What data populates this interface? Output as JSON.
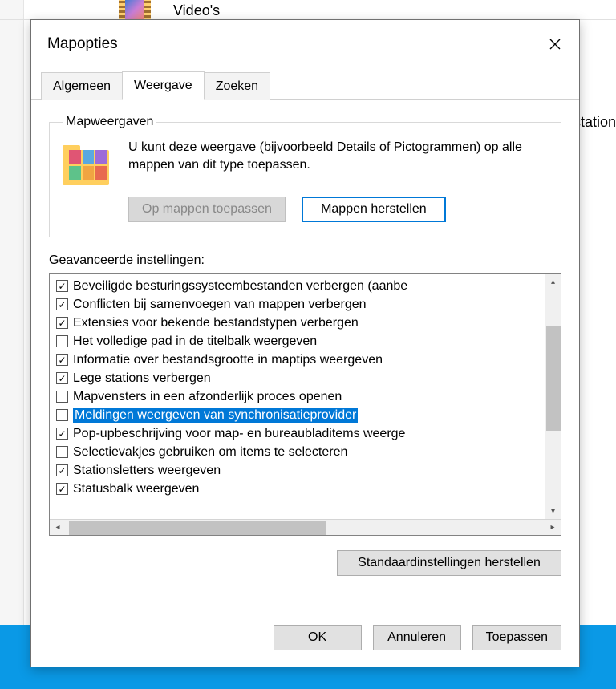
{
  "background": {
    "videos_label": "Video's",
    "station_fragment": "d-station"
  },
  "dialog": {
    "title": "Mapopties",
    "tabs": [
      "Algemeen",
      "Weergave",
      "Zoeken"
    ],
    "active_tab_index": 1,
    "mapweergaven": {
      "legend": "Mapweergaven",
      "description": "U kunt deze weergave (bijvoorbeeld Details of Pictogrammen) op alle mappen van dit type toepassen.",
      "apply_button": "Op mappen toepassen",
      "reset_button": "Mappen herstellen"
    },
    "advanced_label": "Geavanceerde instellingen:",
    "items": [
      {
        "checked": true,
        "selected": false,
        "label": "Beveiligde besturingssysteembestanden verbergen (aanbe"
      },
      {
        "checked": true,
        "selected": false,
        "label": "Conflicten bij samenvoegen van mappen verbergen"
      },
      {
        "checked": true,
        "selected": false,
        "label": "Extensies voor bekende bestandstypen verbergen"
      },
      {
        "checked": false,
        "selected": false,
        "label": "Het volledige pad in de titelbalk weergeven"
      },
      {
        "checked": true,
        "selected": false,
        "label": "Informatie over bestandsgrootte in maptips weergeven"
      },
      {
        "checked": true,
        "selected": false,
        "label": "Lege stations verbergen"
      },
      {
        "checked": false,
        "selected": false,
        "label": "Mapvensters in een afzonderlijk proces openen"
      },
      {
        "checked": false,
        "selected": true,
        "label": "Meldingen weergeven van synchronisatieprovider"
      },
      {
        "checked": true,
        "selected": false,
        "label": "Pop-upbeschrijving voor map- en bureaubladitems weerge"
      },
      {
        "checked": false,
        "selected": false,
        "label": "Selectievakjes gebruiken om items te selecteren"
      },
      {
        "checked": true,
        "selected": false,
        "label": "Stationsletters weergeven"
      },
      {
        "checked": true,
        "selected": false,
        "label": "Statusbalk weergeven"
      }
    ],
    "restore_defaults": "Standaardinstellingen herstellen",
    "buttons": {
      "ok": "OK",
      "cancel": "Annuleren",
      "apply": "Toepassen"
    }
  }
}
